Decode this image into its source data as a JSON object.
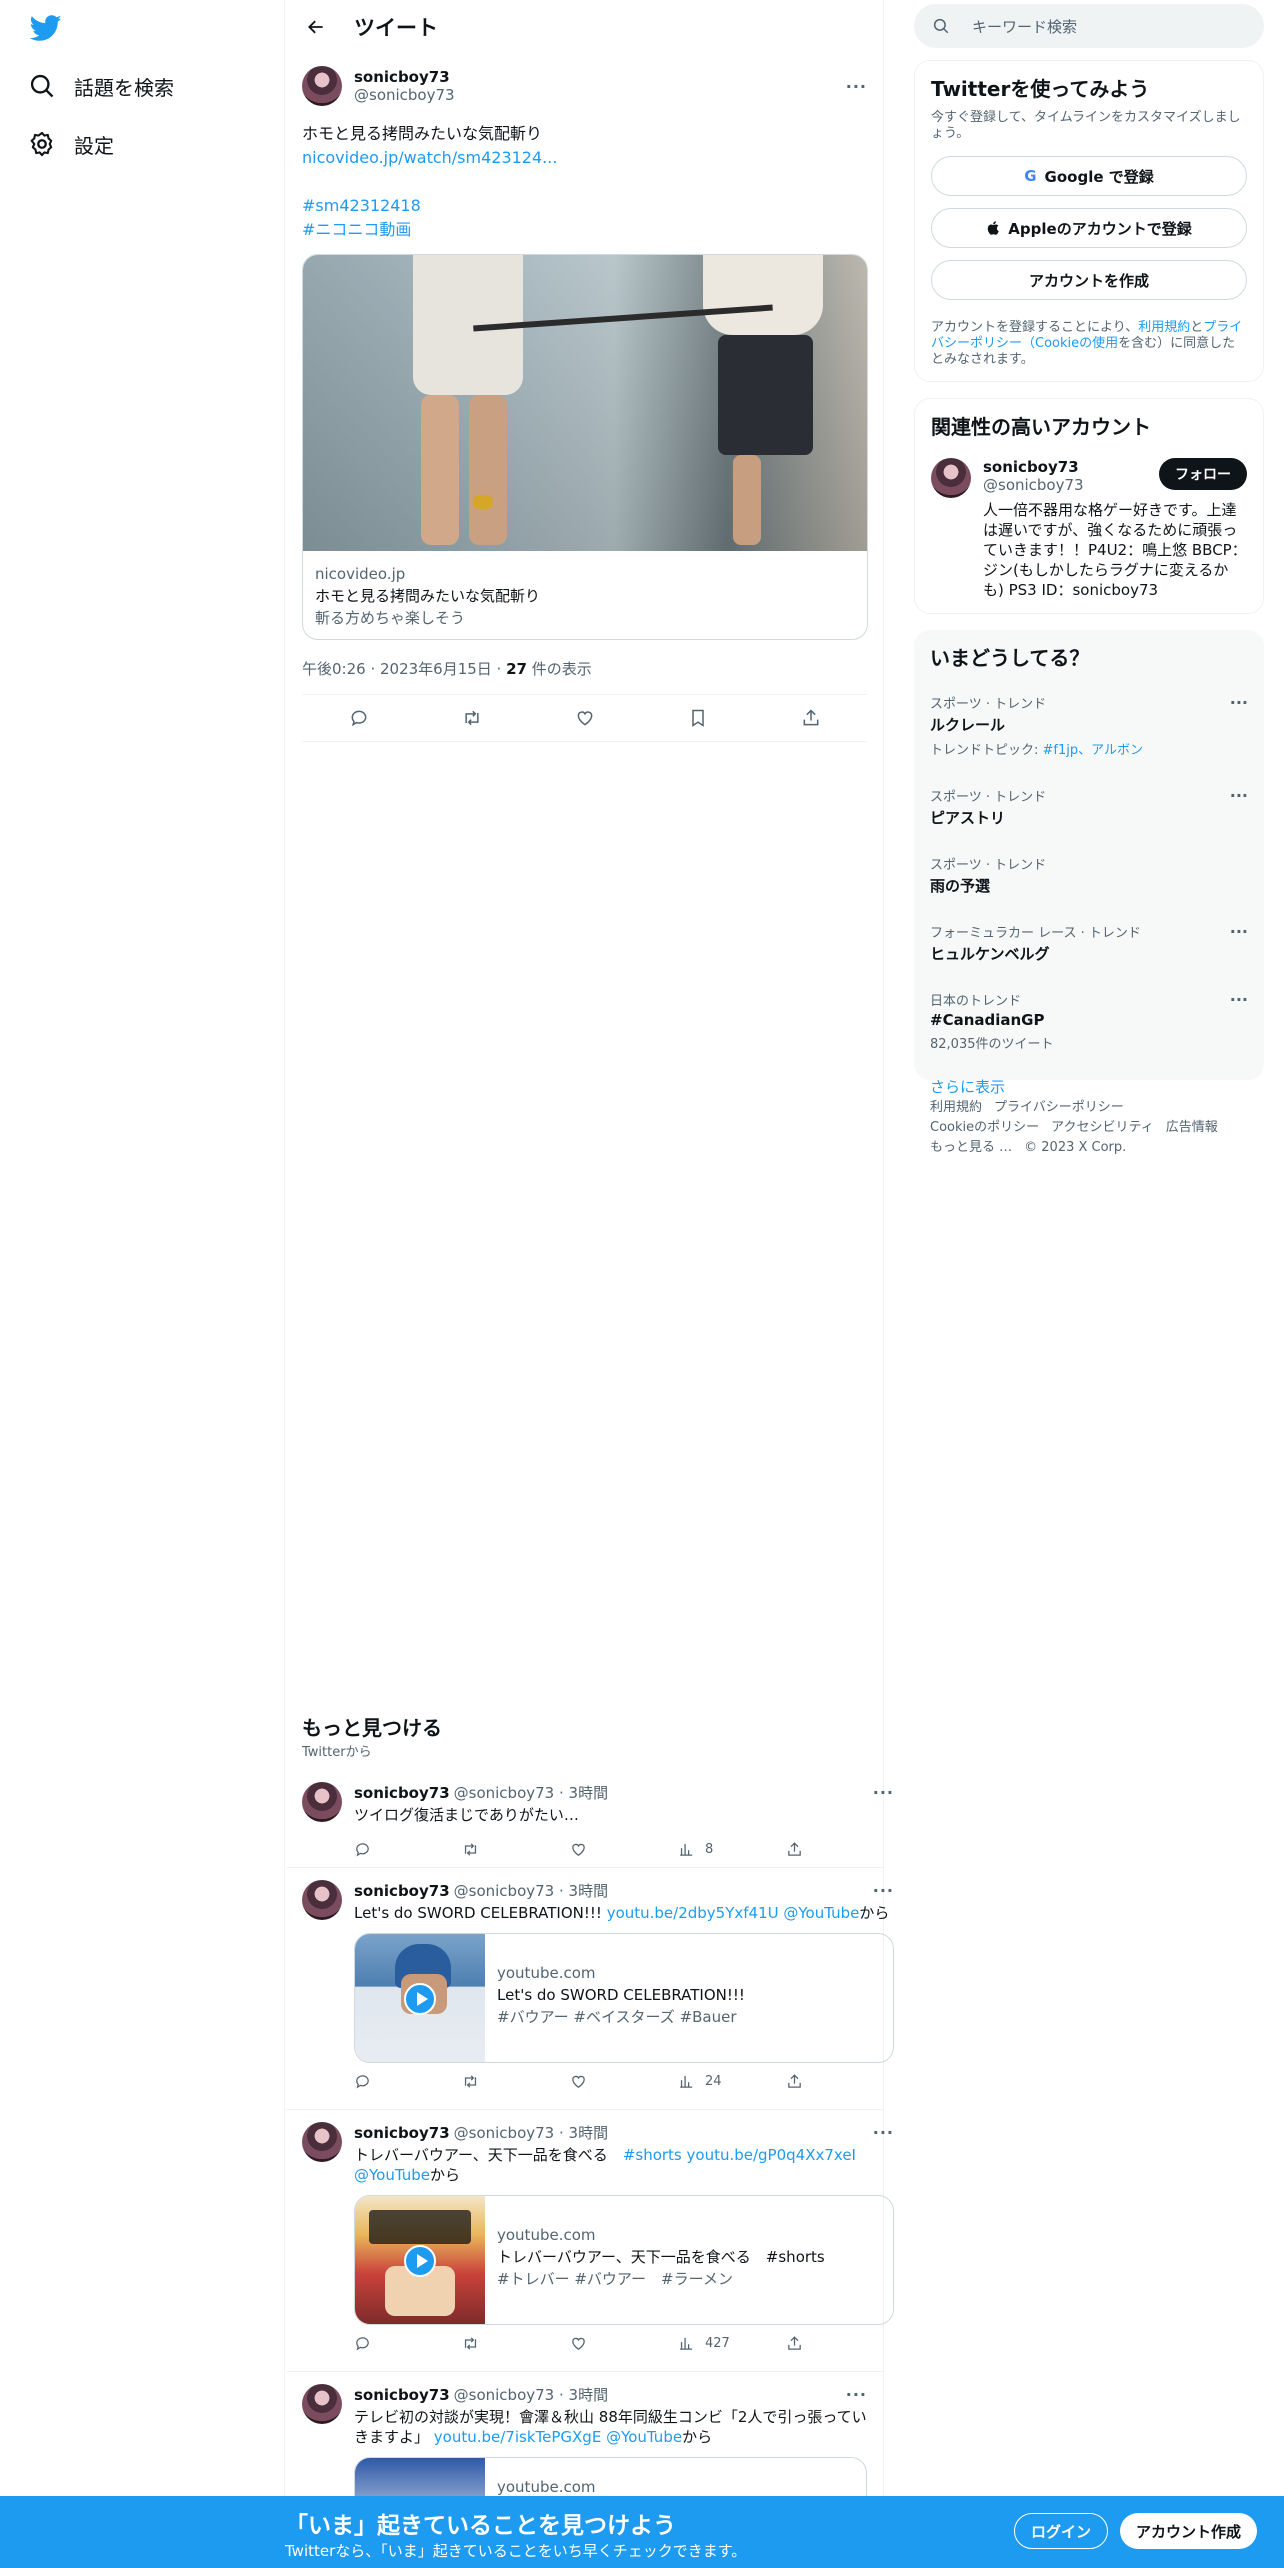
{
  "nav": {
    "logo": "twitter-bird-icon",
    "items": [
      {
        "label": "話題を検索",
        "icon": "search-icon"
      },
      {
        "label": "設定",
        "icon": "gear-icon"
      }
    ]
  },
  "header": {
    "title": "ツイート"
  },
  "tweet": {
    "name": "sonicboy73",
    "handle": "@sonicboy73",
    "text": "ホモと見る拷問みたいな気配斬り",
    "link": "nicovideo.jp/watch/sm423124...",
    "hashtags": [
      "#sm42312418",
      "#ニコニコ動画"
    ],
    "card": {
      "domain": "nicovideo.jp",
      "title": "ホモと見る拷問みたいな気配斬り",
      "desc": "斬る方めちゃ楽しそう"
    },
    "time": "午後0:26 · 2023年6月15日 · ",
    "views_count": "27",
    "views_label": " 件の表示"
  },
  "discover": {
    "title": "もっと見つける",
    "sub": "Twitterから"
  },
  "feed": [
    {
      "name": "sonicboy73",
      "meta": "@sonicboy73 · 3時間",
      "text": "ツイログ復活まじでありがたい…",
      "views": "8"
    },
    {
      "name": "sonicboy73",
      "meta": "@sonicboy73 · 3時間",
      "text": "Let's do SWORD CELEBRATION!!! ",
      "link": "youtu.be/2dby5Yxf41U @YouTube",
      "suffix": "から",
      "card": {
        "domain": "youtube.com",
        "title": "Let's do SWORD CELEBRATION!!!",
        "desc": "#バウアー #ベイスターズ #Bauer"
      },
      "views": "24"
    },
    {
      "name": "sonicboy73",
      "meta": "@sonicboy73 · 3時間",
      "text": "トレバーバウアー、天下一品を食べる　",
      "link": "#shorts youtu.be/gP0q4Xx7xeI @YouTube",
      "suffix": "から",
      "card": {
        "domain": "youtube.com",
        "title": "トレバーバウアー、天下一品を食べる　#shorts",
        "desc": "#トレバー #バウアー　#ラーメン"
      },
      "views": "427"
    },
    {
      "name": "sonicboy73",
      "meta": "@sonicboy73 · 3時間",
      "text": "テレビ初の対談が実現！會澤＆秋山 88年同級生コンビ「2人で引っ張っていきますよ」 ",
      "link": "youtu.be/7iskTePGXgE @YouTube",
      "suffix": "から",
      "card": {
        "domain": "youtube.com"
      }
    }
  ],
  "right": {
    "search_placeholder": "キーワード検索",
    "signup": {
      "title": "Twitterを使ってみよう",
      "sub": "今すぐ登録して、タイムラインをカスタマイズしましょう。",
      "google": "Google で登録",
      "apple": "Appleのアカウントで登録",
      "create": "アカウントを作成",
      "terms_a": "アカウントを登録することにより、",
      "terms_l1": "利用規約",
      "terms_b": "と",
      "terms_l2": "プライバシーポリシー（Cookieの使用",
      "terms_c": "を含む）に同意したとみなされます。"
    },
    "related": {
      "title": "関連性の高いアカウント",
      "name": "sonicboy73",
      "handle": "@sonicboy73",
      "follow": "フォロー",
      "bio": "人一倍不器用な格ゲー好きです。上達は遅いですが、強くなるために頑張っていきます！！P4U2：鳴上悠 BBCP：ジン(もしかしたらラグナに変えるかも) PS3 ID：sonicboy73"
    },
    "trends": {
      "title": "いまどうしてる？",
      "items": [
        {
          "cat": "スポーツ · トレンド",
          "name": "ルクレール",
          "extra_label": "トレンドトピック: ",
          "extra_link": "#f1jp、アルボン"
        },
        {
          "cat": "スポーツ · トレンド",
          "name": "ピアストリ"
        },
        {
          "cat": "スポーツ · トレンド",
          "name": "雨の予選"
        },
        {
          "cat": "フォーミュラカー レース · トレンド",
          "name": "ヒュルケンベルグ"
        },
        {
          "cat": "日本のトレンド",
          "name": "#CanadianGP",
          "count": "82,035件のツイート"
        }
      ],
      "show_more": "さらに表示"
    },
    "footer": [
      "利用規約",
      "プライバシーポリシー",
      "Cookieのポリシー",
      "アクセシビリティ",
      "広告情報",
      "もっと見る …",
      "© 2023 X Corp."
    ]
  },
  "bottombar": {
    "title": "「いま」起きていることを見つけよう",
    "sub": "Twitterなら、「いま」起きていることをいち早くチェックできます。",
    "login": "ログイン",
    "signup": "アカウント作成"
  }
}
